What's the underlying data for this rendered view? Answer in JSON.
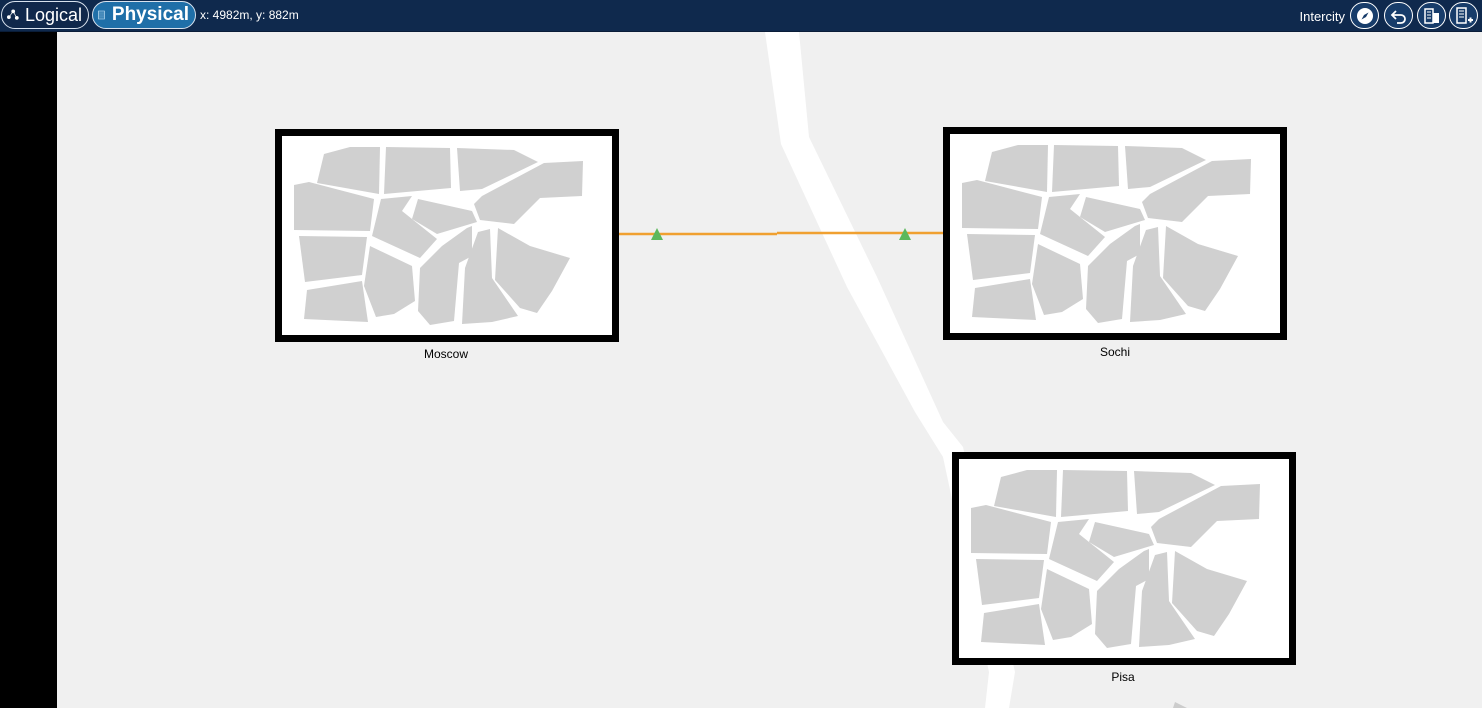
{
  "toolbar": {
    "logical_label": "Logical",
    "physical_label": "Physical",
    "coords": "x: 4982m, y: 882m",
    "environment_label": "Intercity",
    "tools": [
      "navigate-icon",
      "undo-icon",
      "set-background-icon",
      "add-building-icon"
    ]
  },
  "cities": [
    {
      "name": "Moscow"
    },
    {
      "name": "Sochi"
    },
    {
      "name": "Pisa"
    }
  ],
  "colors": {
    "topbar": "#0f294d",
    "physical_active": "#1f6fa8",
    "link": "#f0a030",
    "link_marker": "#5cb85c",
    "map_block": "#d0d0d0"
  }
}
